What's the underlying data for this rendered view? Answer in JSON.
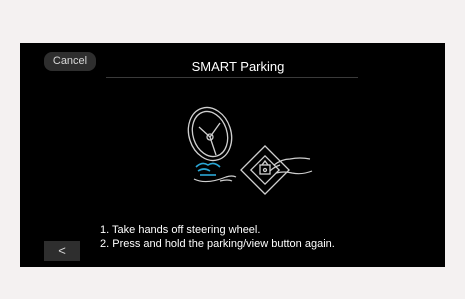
{
  "header": {
    "cancel_label": "Cancel",
    "title": "SMART Parking"
  },
  "illustration": {
    "icons": [
      "steering-wheel-icon",
      "hands-off-icon",
      "parking-view-button-icon",
      "pressing-hand-icon"
    ],
    "accent_color": "#2aa7d6",
    "line_color": "#cfcfcf"
  },
  "instructions": {
    "step1": "1. Take hands off steering wheel.",
    "step2": "2. Press and hold the parking/view button again."
  },
  "footer": {
    "back_icon": "chevron-left-icon",
    "back_label": "<"
  }
}
